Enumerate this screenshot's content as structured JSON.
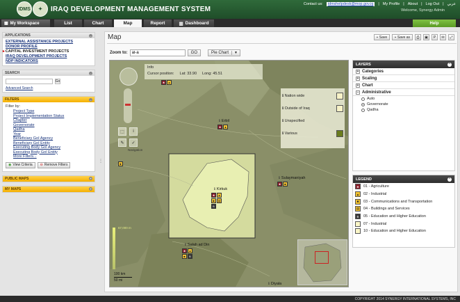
{
  "header": {
    "logo_text": "IDMS",
    "title": "IRAQ DEVELOPMENT MANAGEMENT SYSTEM",
    "contact_label": "Contact us:",
    "contact_email": "idmshelpdesk@mop.gov.iq",
    "links": [
      "My Profile",
      "About",
      "Log Out",
      "عربي"
    ],
    "welcome": "Welcome, Synergy Admin"
  },
  "tabs": {
    "workspace": "My Workspace",
    "items": [
      "List",
      "Chart",
      "Map",
      "Report",
      "Dashboard"
    ],
    "active": "Map",
    "help": "Help"
  },
  "sidebar": {
    "applications_title": "APPLICATIONS",
    "applications": [
      "EXTERNAL ASSISTANCE PROJECTS",
      "DONOR PROFILE",
      "CAPITAL INVESTMENT PROJECTS",
      "IRAQ DEVELOPMENT PROJECTS",
      "NDP INDICATORS"
    ],
    "current_application": "CAPITAL INVESTMENT PROJECTS",
    "search_title": "SEARCH",
    "search_go": "Go",
    "advanced_search": "Advanced Search",
    "filters_title": "FILTERS",
    "filter_by": "Filter by:",
    "filters": [
      "Project Type",
      "Project Implementation Status",
      "Chapter",
      "Governorate",
      "Qadha",
      "Year",
      "Beneficiary GoI Agency",
      "Beneficiary GoI Entity",
      "Executing Body GoI Agency",
      "Executing Body GoI Entity",
      "More Filters..."
    ],
    "view_criteria": "View Criteria",
    "remove_filters": "Remove Filters",
    "public_maps": "PUBLIC MAPS",
    "my_maps": "MY MAPS"
  },
  "main": {
    "title": "Map",
    "save": "Save",
    "save_as": "Save as",
    "zoom_to_label": "Zoom to:",
    "zoom_to_value": "al-a",
    "go": "GO",
    "chart_type": "Pie Chart"
  },
  "map": {
    "info_title": "Info",
    "cursor_label": "Cursor position:",
    "lat_label": "Lat:",
    "lat_value": "33.90",
    "long_label": "Long:",
    "long_value": "45.51",
    "navigation_label": "Navigation",
    "legend_rows": [
      "Nation wide",
      "Outside of Iraq",
      "Unspecified",
      "Various"
    ],
    "cities": [
      "Erbil",
      "Sulaymaniyah",
      "Kirkuk",
      "Salah ad Din",
      "Diyala"
    ],
    "scale_km": "100 km",
    "scale_mi": "50 mi",
    "elevation_label": "67,000 m",
    "colors": {
      "terrain": "#8a8f68",
      "highlight_box": "#d4db9e",
      "selected_region": "#e8efb2",
      "various_swatch": "#6a7c1e"
    }
  },
  "layers": {
    "title": "LAYERS",
    "sections": [
      "Categories",
      "Scaling",
      "Chart",
      "Administrative"
    ],
    "expanded": "Administrative",
    "options": [
      "Auto",
      "Governorate",
      "Qadha"
    ],
    "selected_option": "Governorate"
  },
  "legend": {
    "title": "LEGEND",
    "items": [
      {
        "label": "01 - Agriculture",
        "icon": "tractor-icon",
        "color": "#8b1e2a"
      },
      {
        "label": "02 - Industrial",
        "icon": "factory-icon",
        "color": "#f2c230"
      },
      {
        "label": "03 - Communications and Transportation",
        "icon": "truck-icon",
        "color": "#f2c230"
      },
      {
        "label": "04 - Buildings and Services",
        "icon": "building-icon",
        "color": "#f2c230"
      },
      {
        "label": "05 - Education and Higher Education",
        "icon": "book-icon",
        "color": "#333333"
      },
      {
        "label": "07 - Industrial",
        "icon": "square-icon",
        "color": "#fbf7c8"
      },
      {
        "label": "10 - Education and Higher Education",
        "icon": "square-icon",
        "color": "#fbf7c8"
      }
    ]
  },
  "footer": {
    "copyright": "COPYRIGHT 2014 SYNERGY INTERNATIONAL SYSTEMS, INC"
  }
}
